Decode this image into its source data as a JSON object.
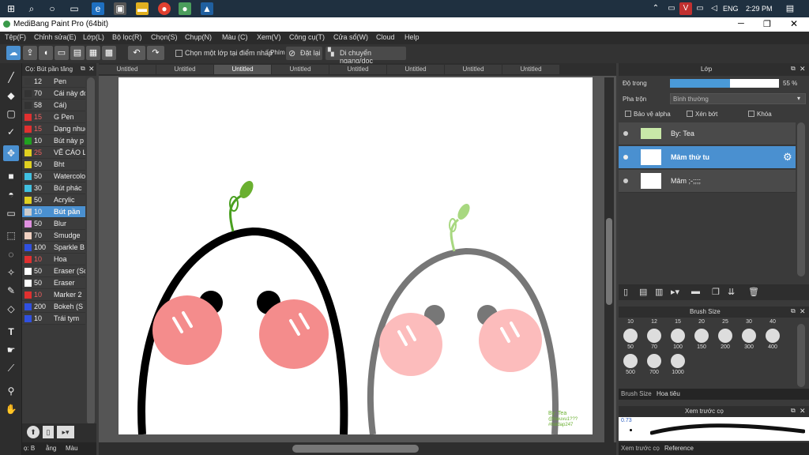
{
  "taskbar": {
    "lang": "ENG",
    "time": "2:29 PM"
  },
  "app": {
    "title": "MediBang Paint Pro (64bit)"
  },
  "menu": [
    "Tệp(F)",
    "Chỉnh sửa(E)",
    "Lớp(L)",
    "Bộ lọc(R)",
    "Chọn(S)",
    "Chụp(N)",
    "Màu (C)",
    "Xem(V)",
    "Công cụ(T)",
    "Cửa sổ(W)",
    "Cloud",
    "Help"
  ],
  "toolbar": {
    "select_layer_label": "Chọn một lớp tại điểm nhấp",
    "phim_label": "Phím",
    "reset_label": "Đặt lại",
    "move_label": "Di chuyển ngang/dọc"
  },
  "brushes": {
    "header": "Cọ: Bút pần tăng",
    "items": [
      {
        "size": "12",
        "name": "Pen",
        "color": "#3a3a3a"
      },
      {
        "size": "70",
        "name": "Cái này đó",
        "color": "#333333"
      },
      {
        "size": "58",
        "name": "Cái)",
        "color": "#333333"
      },
      {
        "size": "15",
        "name": "G Pen",
        "color": "#e03030"
      },
      {
        "size": "15",
        "name": "Dạng nhuộm",
        "color": "#e03030"
      },
      {
        "size": "10",
        "name": "Bút này p",
        "color": "#20a020"
      },
      {
        "size": "25",
        "name": "VẼ CÁO L",
        "color": "#e0d020"
      },
      {
        "size": "50",
        "name": "Bht",
        "color": "#e0d020"
      },
      {
        "size": "50",
        "name": "Watercolor",
        "color": "#40c0e0"
      },
      {
        "size": "30",
        "name": "Bút phác",
        "color": "#40c0e0"
      },
      {
        "size": "50",
        "name": "Acrylic",
        "color": "#e0d020"
      },
      {
        "size": "10",
        "name": "Bút pần",
        "color": "#cccccc"
      },
      {
        "size": "50",
        "name": "Blur",
        "color": "#e090e0"
      },
      {
        "size": "70",
        "name": "Smudge",
        "color": "#f0d0c0"
      },
      {
        "size": "100",
        "name": "Sparkle B",
        "color": "#3050e0"
      },
      {
        "size": "10",
        "name": "Hoa",
        "color": "#e03030"
      },
      {
        "size": "50",
        "name": "Eraser (Sc",
        "color": "#ffffff"
      },
      {
        "size": "50",
        "name": "Eraser",
        "color": "#ffffff"
      },
      {
        "size": "10",
        "name": "Marker 2",
        "color": "#e03030"
      },
      {
        "size": "200",
        "name": "Bokeh (S",
        "color": "#3050e0"
      },
      {
        "size": "10",
        "name": "Trái tym",
        "color": "#3050e0"
      }
    ],
    "bottom_tabs": [
      "ọ: B",
      "ằng",
      "Màu"
    ]
  },
  "tabs": [
    "Untitled",
    "Untitled",
    "Untitled",
    "Untitled",
    "Untitled",
    "Untitled",
    "Untitled",
    "Untitled"
  ],
  "canvas": {
    "signature": "By: Tea",
    "sig2": "@hieuvu1???",
    "sig3": "#hoidap247"
  },
  "layers_panel": {
    "title": "Lớp",
    "opacity_label": "Độ trong",
    "opacity_value": "55 %",
    "opacity_fraction": 0.55,
    "blend_label": "Pha trộn",
    "blend_value": "Bình thường",
    "protect_alpha": "Bảo vệ alpha",
    "clip": "Xén bớt",
    "lock": "Khóa",
    "layers": [
      {
        "name": "By: Tea"
      },
      {
        "name": "Mâm thử tu"
      },
      {
        "name": "Mâm ;-;;;;"
      }
    ]
  },
  "brush_size": {
    "title": "Brush Size",
    "top_row": [
      "10",
      "12",
      "15",
      "20",
      "25",
      "30",
      "40"
    ],
    "row1": [
      "50",
      "70",
      "100",
      "150",
      "200",
      "300",
      "400"
    ],
    "row2": [
      "500",
      "700",
      "1000"
    ],
    "tabs": [
      "Brush Size",
      "Hoa tiêu"
    ]
  },
  "preview": {
    "title": "Xem trước cọ",
    "value": "0.73",
    "tabs": [
      "Xem trước cọ",
      "Reference"
    ]
  },
  "colors": {
    "accent": "#4a90d0",
    "canvas": "#ffffff"
  }
}
